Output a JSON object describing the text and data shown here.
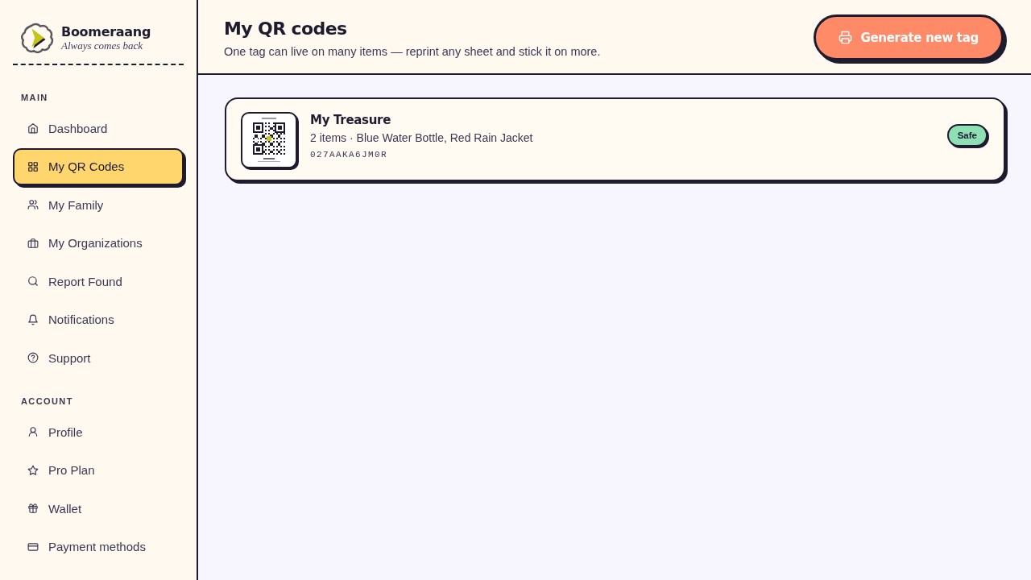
{
  "sidebar": {
    "brand": {
      "name": "Boomeraang",
      "tagline": "Always comes back"
    },
    "sections": [
      {
        "heading": "MAIN",
        "items": [
          {
            "label": "Dashboard",
            "selected": false
          },
          {
            "label": "My QR Codes",
            "selected": true
          },
          {
            "label": "My Family",
            "selected": false
          },
          {
            "label": "My Organizations",
            "selected": false
          },
          {
            "label": "Report Found",
            "selected": false
          },
          {
            "label": "Notifications",
            "selected": false
          },
          {
            "label": "Support",
            "selected": false
          }
        ]
      },
      {
        "heading": "ACCOUNT",
        "items": [
          {
            "label": "Profile",
            "selected": false
          },
          {
            "label": "Pro Plan",
            "selected": false
          },
          {
            "label": "Wallet",
            "selected": false
          },
          {
            "label": "Payment methods",
            "selected": false
          }
        ]
      }
    ]
  },
  "header": {
    "title": "My QR codes",
    "subtitle": "One tag can live on many items — reprint any sheet and stick it on more.",
    "primary_button": "Generate new tag"
  },
  "tags": [
    {
      "name": "My Treasure",
      "summary": "2 items · Blue Water Bottle, Red Rain Jacket",
      "code": "027AAKA6JM0R",
      "status": {
        "label": "Safe",
        "color": "#8ee0b4"
      }
    }
  ]
}
